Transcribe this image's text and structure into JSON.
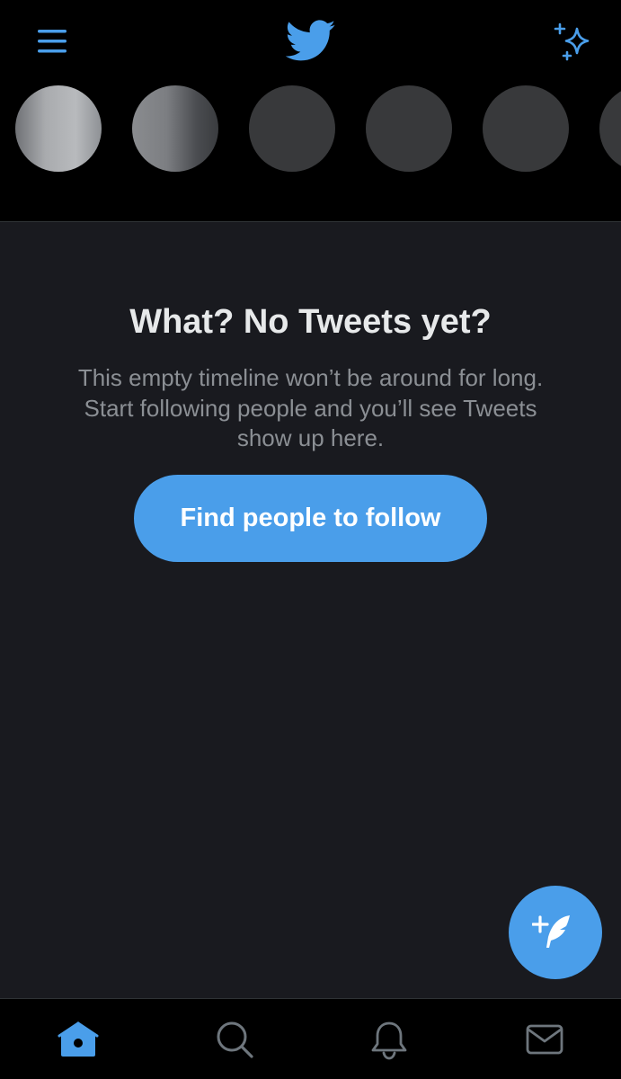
{
  "header": {
    "menu_icon": "hamburger-menu-icon",
    "logo_icon": "twitter-bird-icon",
    "sparkle_icon": "sparkle-icon"
  },
  "fleets": {
    "count": 6
  },
  "empty_state": {
    "title": "What? No Tweets yet?",
    "body": "This empty timeline won’t be around for long. Start following people and you’ll see Tweets show up here.",
    "button_label": "Find people to follow"
  },
  "compose": {
    "icon": "compose-tweet-icon"
  },
  "bottom_nav": {
    "items": [
      {
        "icon": "home-icon",
        "active": true
      },
      {
        "icon": "search-icon",
        "active": false
      },
      {
        "icon": "bell-icon",
        "active": false
      },
      {
        "icon": "mail-icon",
        "active": false
      }
    ]
  },
  "colors": {
    "accent": "#4a9eea",
    "background_header": "#000000",
    "background_main": "#191a1f",
    "title_text": "#e7e9ea",
    "body_text": "#8b8f94",
    "inactive_icon": "#6e767d"
  }
}
